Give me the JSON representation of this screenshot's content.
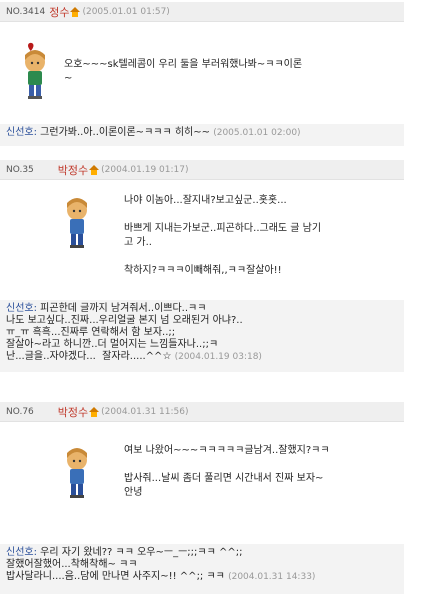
{
  "posts": [
    {
      "no": "NO.3414",
      "name": "정수",
      "date": "(2005.01.01 01:57)",
      "message": "오호~~~sk텔레콤이 우리 둘을 부러워했나봐~ㅋㅋ이론\n~",
      "reply_name": "신선호:",
      "reply_text": "그런가봐..아..이론이론~ㅋㅋㅋ 히히~~",
      "reply_date": "(2005.01.01 02:00)"
    },
    {
      "no": "NO.35",
      "name": "박정수",
      "date": "(2004.01.19 01:17)",
      "message": "나야 이놈아...잘지내?보고싶군..홋홋...\n\n바쁘게 지내는가보군..피곤하다..그래도 글 남기\n고 가..\n\n착하지?ㅋㅋㅋ이빼해줘,,ㅋㅋ잘살아!!",
      "reply_name": "신선호:",
      "reply_text": "피곤한데 글까지 남겨줘서..이쁘다..ㅋㅋ\n나도 보고싶다..진짜...우리얼굴 본지 넘 오래된거 아냐?..\nㅠ_ㅠ 흑흑...진짜루 연락해서 함 보자..;;\n잘살아~라고 하니깐..더 멀어지는 느낌들자나..;;ㅋ\n난...글을..자야겠다...  잘자라.....^^☆",
      "reply_date": "(2004.01.19 03:18)"
    },
    {
      "no": "NO.76",
      "name": "박정수",
      "date": "(2004.01.31 11:56)",
      "message": "여보 나왔어~~~ㅋㅋㅋㅋㅋ글남겨..잘했지?ㅋㅋ\n\n밥사줘...날씨 좀더 풀리면 시간내서 진짜 보자~\n안녕",
      "reply_name": "신선호:",
      "reply_text": "우리 자기 왔네?? ㅋㅋ 오우~ㅡ_ㅡ;;;ㅋㅋ ^^;;\n잘했어잘했어...착해착해~ ㅋㅋ\n밥사달라니....음..담에 만나면 사주지~!! ^^;; ㅋㅋ",
      "reply_date": "(2004.01.31 14:33)"
    }
  ],
  "icons": {
    "home": "minihompy-home-icon",
    "heart": "heart-icon",
    "avatar": "minimi-avatar"
  },
  "colors": {
    "name": "#c0392b",
    "reply_name": "#2a4f9a",
    "date": "#999999",
    "header_bg": "#efefef",
    "reply_bg": "#f3f3f3"
  }
}
